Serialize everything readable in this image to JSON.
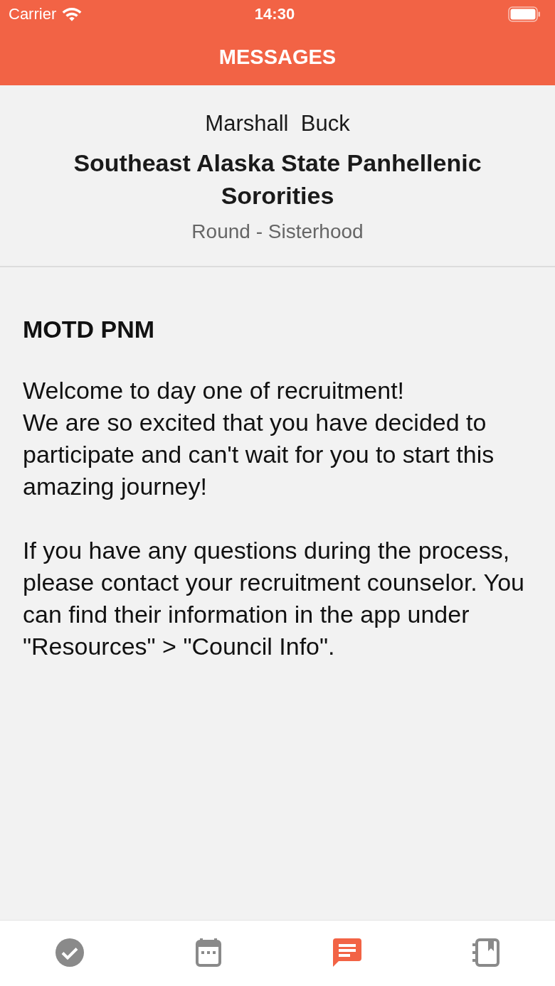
{
  "status_bar": {
    "carrier": "Carrier",
    "time": "14:30"
  },
  "nav": {
    "title": "MESSAGES"
  },
  "header": {
    "sender": "Marshall  Buck",
    "organization": "Southeast Alaska State Panhellenic Sororities",
    "round": "Round - Sisterhood"
  },
  "message": {
    "title": "MOTD PNM",
    "paragraphs": [
      "Welcome to day one of recruitment!\nWe are so excited that you have decided to participate and can't wait for you to start this amazing journey!",
      "If you have any questions during the process, please contact your recruitment counselor. You can find their information in the app under \"Resources\" > \"Council Info\"."
    ]
  },
  "tab_bar": [
    {
      "kind": "check",
      "selected": false
    },
    {
      "kind": "calendar",
      "selected": false
    },
    {
      "kind": "messages",
      "selected": true
    },
    {
      "kind": "notebook",
      "selected": false
    }
  ]
}
